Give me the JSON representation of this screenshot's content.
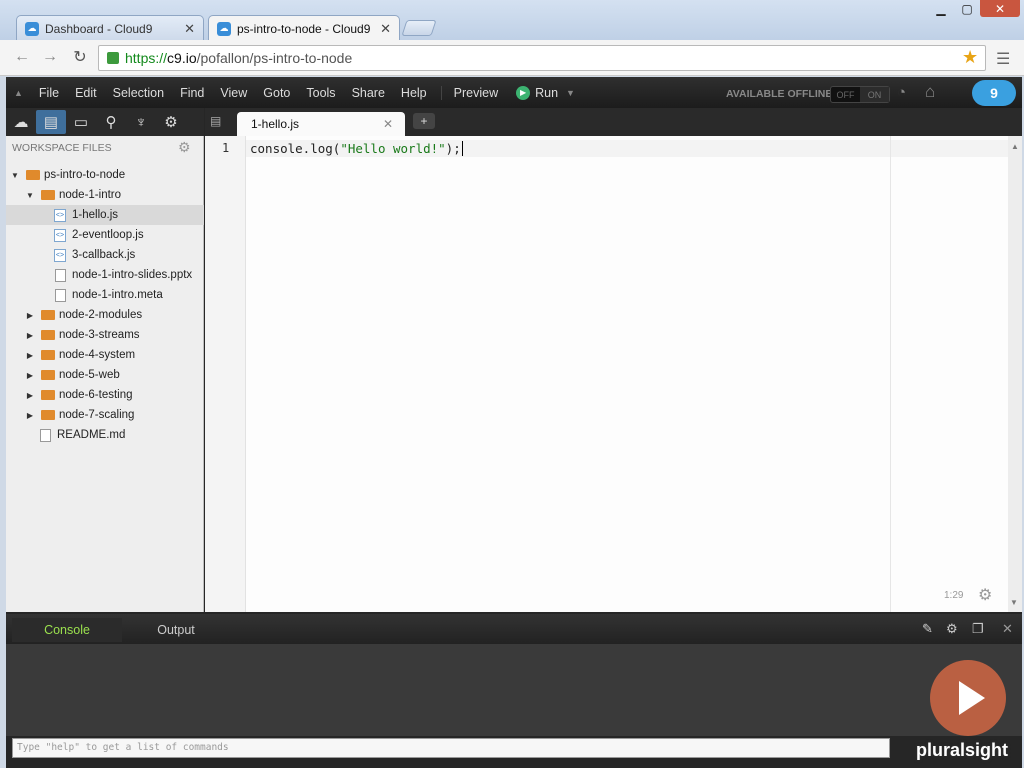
{
  "browser": {
    "tabs": [
      {
        "label": "Dashboard - Cloud9",
        "favicon": "cloud9-icon",
        "active": false
      },
      {
        "label": "ps-intro-to-node - Cloud9",
        "favicon": "cloud9-icon",
        "active": true
      }
    ],
    "url": {
      "scheme": "https://",
      "host": "c9.io",
      "path": "/pofallon/ps-intro-to-node"
    }
  },
  "menubar": {
    "items": [
      "File",
      "Edit",
      "Selection",
      "Find",
      "View",
      "Goto",
      "Tools",
      "Share",
      "Help"
    ],
    "preview": "Preview",
    "run": "Run",
    "offline_label": "AVAILABLE OFFLINE",
    "toggle": {
      "off": "OFF",
      "on": "ON"
    },
    "logo": "9"
  },
  "sidebar": {
    "title": "WORKSPACE FILES",
    "tree": [
      {
        "name": "ps-intro-to-node",
        "type": "folder",
        "expanded": true,
        "depth": 0
      },
      {
        "name": "node-1-intro",
        "type": "folder",
        "expanded": true,
        "depth": 1
      },
      {
        "name": "1-hello.js",
        "type": "js",
        "depth": 2,
        "selected": true
      },
      {
        "name": "2-eventloop.js",
        "type": "js",
        "depth": 2
      },
      {
        "name": "3-callback.js",
        "type": "js",
        "depth": 2
      },
      {
        "name": "node-1-intro-slides.pptx",
        "type": "file",
        "depth": 2
      },
      {
        "name": "node-1-intro.meta",
        "type": "file",
        "depth": 2
      },
      {
        "name": "node-2-modules",
        "type": "folder",
        "expanded": false,
        "depth": 1
      },
      {
        "name": "node-3-streams",
        "type": "folder",
        "expanded": false,
        "depth": 1
      },
      {
        "name": "node-4-system",
        "type": "folder",
        "expanded": false,
        "depth": 1
      },
      {
        "name": "node-5-web",
        "type": "folder",
        "expanded": false,
        "depth": 1
      },
      {
        "name": "node-6-testing",
        "type": "folder",
        "expanded": false,
        "depth": 1
      },
      {
        "name": "node-7-scaling",
        "type": "folder",
        "expanded": false,
        "depth": 1
      },
      {
        "name": "README.md",
        "type": "file",
        "depth": 1
      }
    ]
  },
  "editor": {
    "tab": "1-hello.js",
    "line_number": "1",
    "code_plain": "console.log(",
    "code_string": "\"Hello world!\"",
    "code_end": ");",
    "cursor": "1:29"
  },
  "console": {
    "tabs": [
      "Console",
      "Output"
    ],
    "placeholder": "Type \"help\" to get a list of commands"
  },
  "watermark": "pluralsight"
}
